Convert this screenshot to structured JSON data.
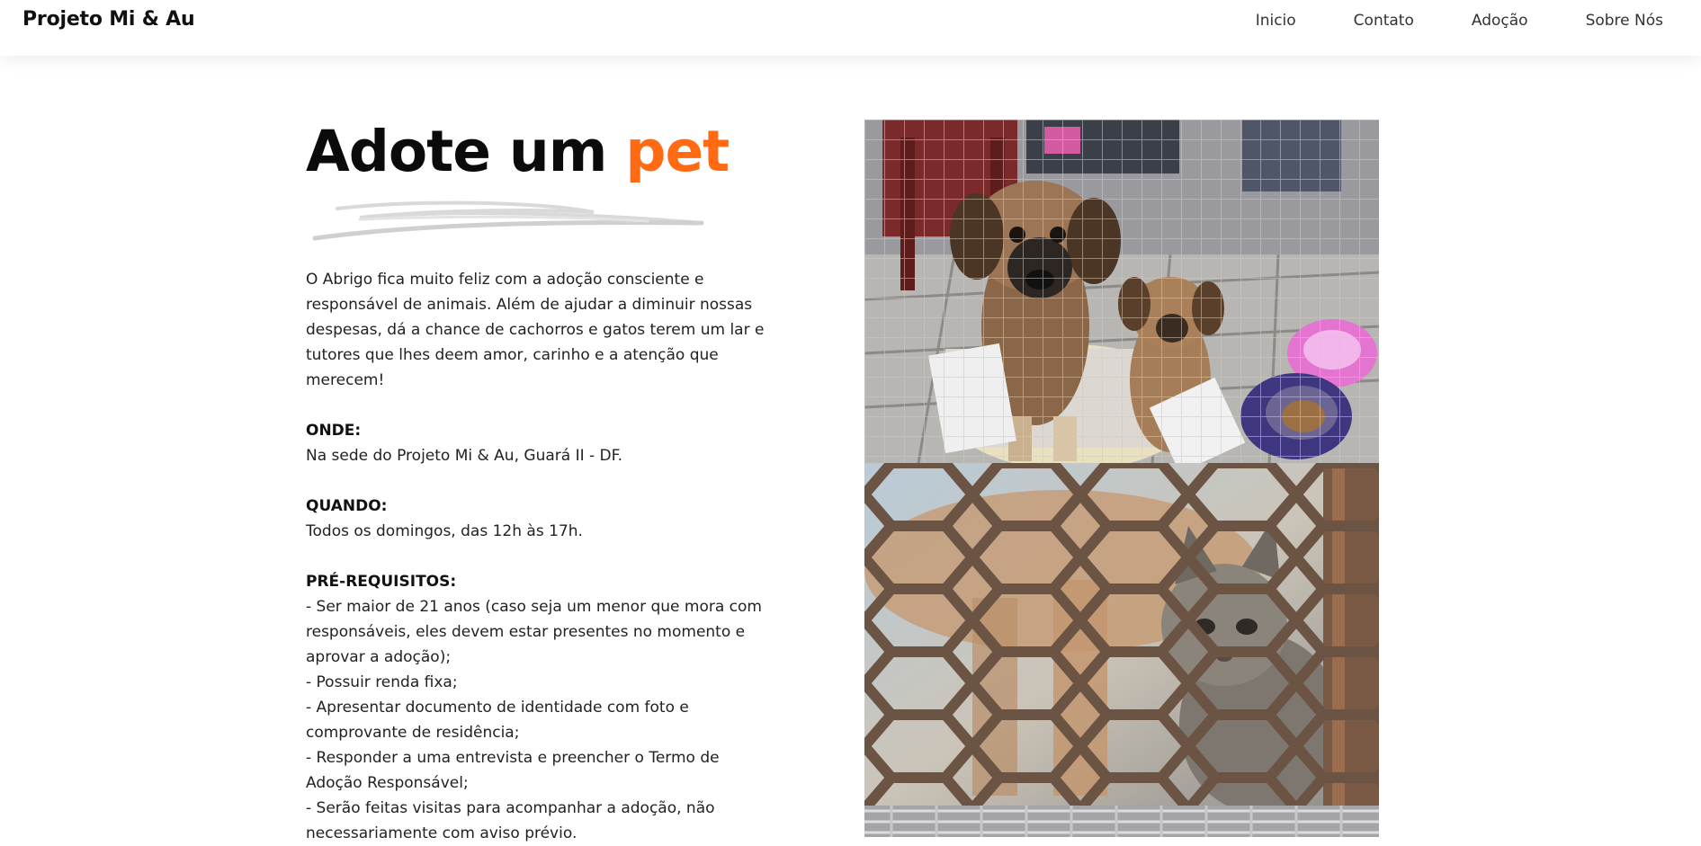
{
  "navbar": {
    "brand": "Projeto Mi & Au",
    "links": [
      "Inicio",
      "Contato",
      "Adoção",
      "Sobre Nós"
    ]
  },
  "hero": {
    "title_main": "Adote um ",
    "title_accent": "pet",
    "accent_color": "#ff6a13"
  },
  "content": {
    "intro": "O Abrigo fica muito feliz com a adoção consciente e responsável de animais. Além de ajudar a diminuir nossas despesas, dá a chance de cachorros e gatos terem um lar e tutores que lhes deem amor, carinho e a atenção que merecem!",
    "where_label": "ONDE:",
    "where_text": "Na sede do Projeto Mi & Au, Guará II - DF.",
    "when_label": "QUANDO:",
    "when_text": "Todos os domingos, das 12h às 17h.",
    "req_label": "PRÉ-REQUISITOS:",
    "requirements": [
      "- Ser maior de 21 anos (caso seja um menor que mora com responsáveis, eles devem estar presentes no momento e aprovar a adoção);",
      "- Possuir renda fixa;",
      "- Apresentar documento de identidade com foto e comprovante de residência;",
      "- Responder a uma entrevista e preencher o Termo de Adoção Responsável;",
      "- Serão feitas visitas para acompanhar a adoção, não necessariamente com aviso prévio."
    ]
  },
  "photos": {
    "dogs_icon": "dog-photo",
    "cat_icon": "cat-photo"
  }
}
